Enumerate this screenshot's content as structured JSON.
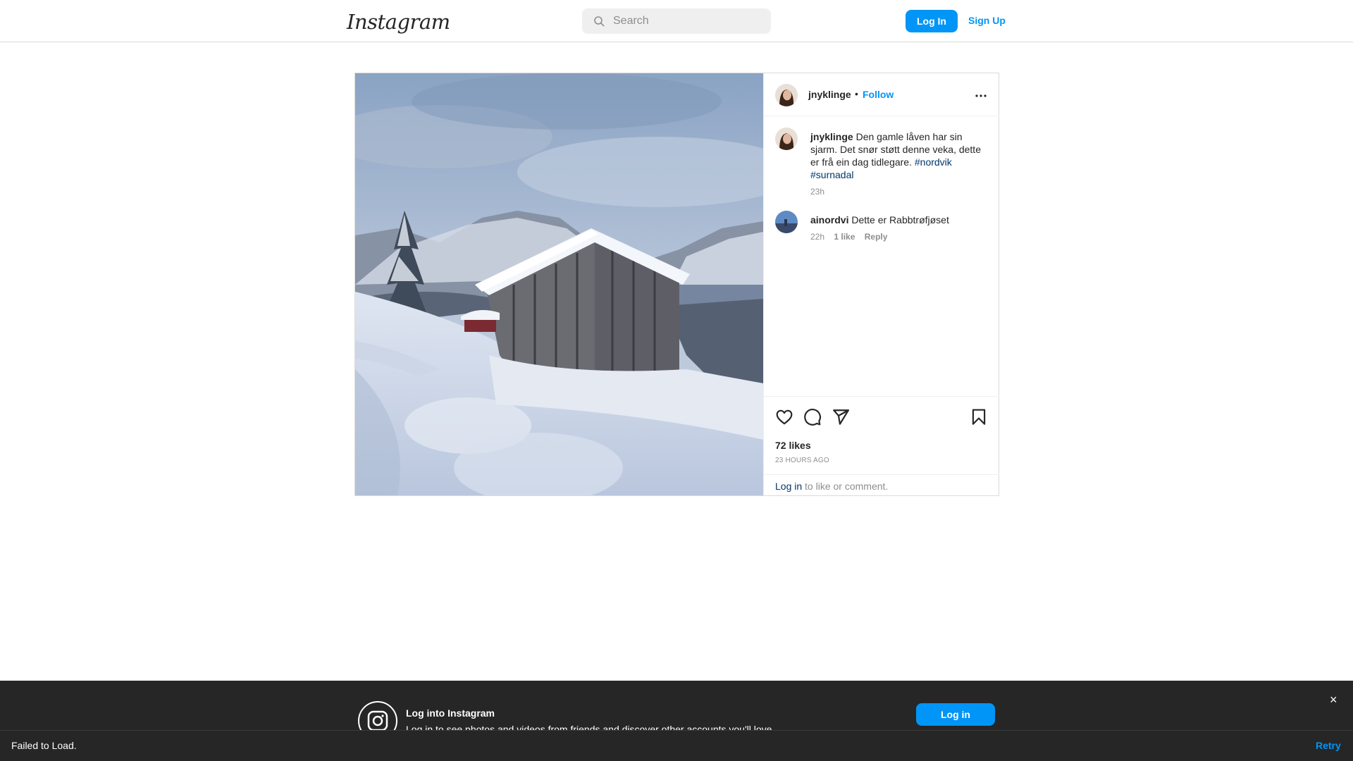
{
  "header": {
    "logo": "Instagram",
    "search_placeholder": "Search",
    "login_label": "Log In",
    "signup_label": "Sign Up"
  },
  "post": {
    "username": "jnyklinge",
    "separator": "•",
    "follow_label": "Follow",
    "caption": {
      "username": "jnyklinge",
      "text": "Den gamle låven har sin sjarm. Det snør støtt denne veka, dette er frå ein dag tidlegare.",
      "tag1": "#nordvik",
      "tag2": "#surnadal",
      "time": "23h"
    },
    "comments": [
      {
        "username": "ainordvi",
        "text": "Dette er Rabbtrøfjøset",
        "time": "22h",
        "likes": "1 like",
        "reply_label": "Reply"
      }
    ],
    "likes": "72 likes",
    "posted_ago": "23 HOURS AGO",
    "login_prompt_link": "Log in",
    "login_prompt_text": "to like or comment."
  },
  "banner": {
    "title": "Log into Instagram",
    "text": "Log in to see photos and videos from friends and discover other accounts you'll love.",
    "button_label": "Log in",
    "close_symbol": "×"
  },
  "toast": {
    "message": "Failed to Load.",
    "retry_label": "Retry"
  },
  "icons": [
    "search-icon",
    "more-icon",
    "heart-icon",
    "comment-icon",
    "share-icon",
    "bookmark-icon",
    "instagram-icon",
    "close-icon"
  ],
  "colors": {
    "accent": "#0095f6",
    "hashtag": "#00376b",
    "muted": "#8e8e8e",
    "banner_bg": "#262626"
  }
}
